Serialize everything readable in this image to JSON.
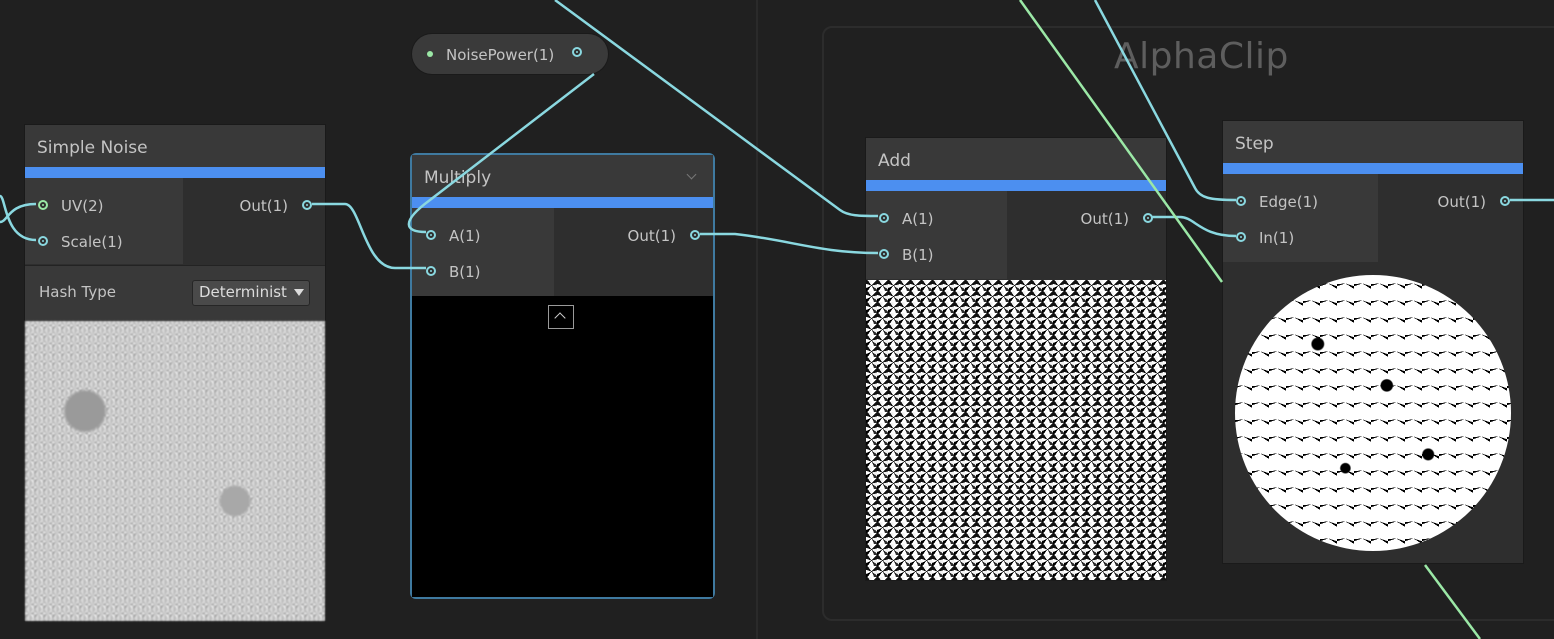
{
  "group": {
    "title": "AlphaClip"
  },
  "property": {
    "label": "NoisePower(1)"
  },
  "nodes": {
    "simple_noise": {
      "title": "Simple Noise",
      "inputs": [
        "UV(2)",
        "Scale(1)"
      ],
      "output": "Out(1)",
      "hash_type_label": "Hash Type",
      "hash_type_value": "Determinist"
    },
    "multiply": {
      "title": "Multiply",
      "inputs": [
        "A(1)",
        "B(1)"
      ],
      "output": "Out(1)"
    },
    "add": {
      "title": "Add",
      "inputs": [
        "A(1)",
        "B(1)"
      ],
      "output": "Out(1)"
    },
    "step": {
      "title": "Step",
      "inputs": [
        "Edge(1)",
        "In(1)"
      ],
      "output": "Out(1)"
    }
  },
  "colors": {
    "wire": "#8ad8e0",
    "wire_vector": "#9be8a6",
    "node_header_accent": "#4c8ff0",
    "selection_outline": "#3f7aa0"
  },
  "icons": [
    "chevron-down-icon",
    "chevron-up-icon",
    "dropdown-arrow-icon"
  ]
}
